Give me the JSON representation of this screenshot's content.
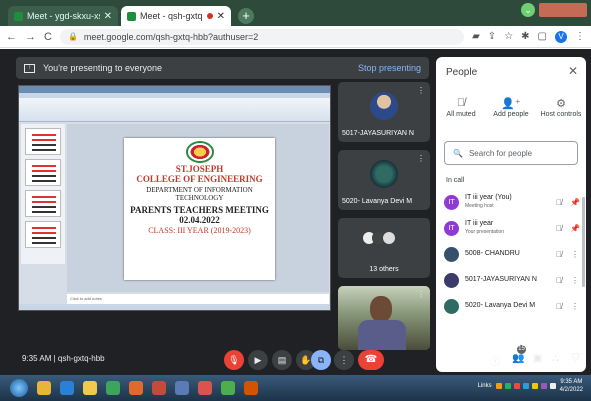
{
  "browser": {
    "tabs": [
      {
        "title": "Meet - ygd-skxu-xsa",
        "active": false
      },
      {
        "title": "Meet - qsh-gxtq-hbb",
        "active": true
      }
    ],
    "new_tab": "+",
    "url": "meet.google.com/qsh-gxtq-hbb?authuser=2",
    "profile_initial": "V"
  },
  "presenting": {
    "message": "You're presenting to everyone",
    "stop_label": "Stop presenting"
  },
  "slide": {
    "line1": "ST.JOSEPH",
    "line2": "COLLEGE OF ENGINEERING",
    "line3": "DEPARTMENT OF INFORMATION",
    "line4": "TECHNOLOGY",
    "line5": "PARENTS TEACHERS MEETING",
    "line6": "02.04.2022",
    "line7": "CLASS: III YEAR (2019-2023)",
    "notes": "Click to add notes"
  },
  "tiles": [
    {
      "name": "5017-JAYASURIYAN N"
    },
    {
      "name": "5020- Lavanya Devi M"
    },
    {
      "name": "13 others"
    }
  ],
  "people_panel": {
    "title": "People",
    "actions": [
      {
        "label": "All muted",
        "icon": "mic-off-icon"
      },
      {
        "label": "Add people",
        "icon": "add-person-icon"
      },
      {
        "label": "Host controls",
        "icon": "host-controls-icon"
      }
    ],
    "search_placeholder": "Search for people",
    "section": "In call",
    "participants": [
      {
        "name": "IT iii year (You)",
        "sub": "Meeting host",
        "initial": "IT",
        "color": "#8e3ad6"
      },
      {
        "name": "IT iii year",
        "sub": "Your presentation",
        "initial": "IT",
        "color": "#8e3ad6"
      },
      {
        "name": "5008- CHANDRU",
        "sub": "",
        "initial": "",
        "color": "#35506a"
      },
      {
        "name": "5017-JAYASURIYAN N",
        "sub": "",
        "initial": "",
        "color": "#3b3b6b"
      },
      {
        "name": "5020- Lavanya Devi M",
        "sub": "",
        "initial": "",
        "color": "#2f6b63"
      }
    ]
  },
  "controls": {
    "time": "9:35 AM",
    "separator": "|",
    "meeting_code": "qsh-gxtq-hbb",
    "people_count": "15"
  },
  "taskbar": {
    "links_label": "Links",
    "time": "9:35 AM",
    "date": "4/2/2022"
  }
}
